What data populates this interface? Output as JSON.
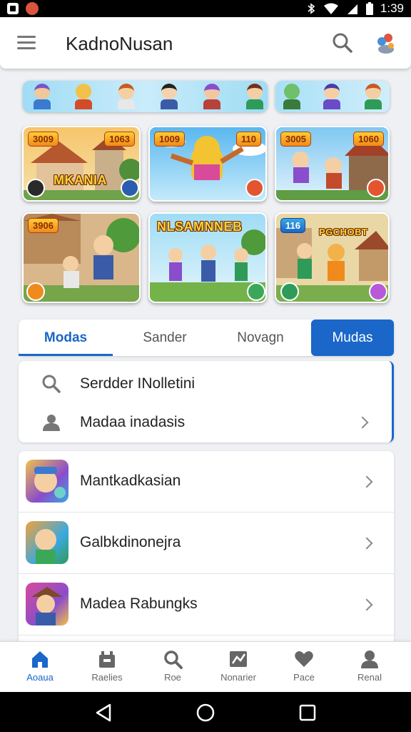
{
  "status_bar": {
    "time": "1:39"
  },
  "app_bar": {
    "title": "KadnoNusan"
  },
  "cards": [
    {
      "tag_left": "3009",
      "tag_right": "1063",
      "title": "MKANIA"
    },
    {
      "tag_left": "1009",
      "tag_right": "110"
    },
    {
      "tag_left": "3005",
      "tag_right": "1060"
    },
    {
      "tag_left": "3906"
    },
    {
      "title": "NLSAMNNEB"
    },
    {
      "tag_left": "116",
      "title": "PGCHOBT"
    }
  ],
  "tabs": [
    {
      "label": "Modas"
    },
    {
      "label": "Sander"
    },
    {
      "label": "Novagn"
    },
    {
      "label": "Mudas"
    }
  ],
  "search_panel": {
    "search_label": "Serdder INolletini",
    "user_label": "Madaa inadasis"
  },
  "list": [
    {
      "label": "Mantkadkasian"
    },
    {
      "label": "Galbkdinonejra"
    },
    {
      "label": "Madea Rabungks"
    }
  ],
  "bottom_nav": [
    {
      "label": "Aoaua",
      "icon": "home-icon"
    },
    {
      "label": "Raelies",
      "icon": "store-icon"
    },
    {
      "label": "Roe",
      "icon": "search-icon"
    },
    {
      "label": "Nonarier",
      "icon": "news-icon"
    },
    {
      "label": "Pace",
      "icon": "heart-icon"
    },
    {
      "label": "Renal",
      "icon": "profile-icon"
    }
  ],
  "colors": {
    "accent": "#1a66c9",
    "background": "#eef0f3"
  }
}
